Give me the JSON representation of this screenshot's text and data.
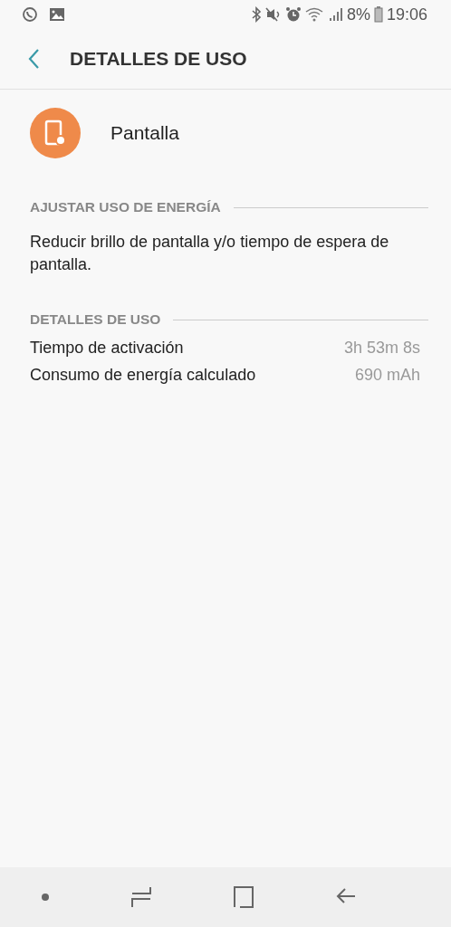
{
  "status_bar": {
    "battery": "8%",
    "time": "19:06"
  },
  "header": {
    "title": "DETALLES DE USO"
  },
  "app": {
    "name": "Pantalla"
  },
  "sections": [
    {
      "title": "AJUSTAR USO DE ENERGÍA",
      "text": "Reducir brillo de pantalla y/o tiempo de espera de pantalla."
    },
    {
      "title": "DETALLES DE USO",
      "rows": [
        {
          "label": "Tiempo de activación",
          "value": "3h 53m 8s"
        },
        {
          "label": "Consumo de energía calculado",
          "value": "690 mAh"
        }
      ]
    }
  ]
}
